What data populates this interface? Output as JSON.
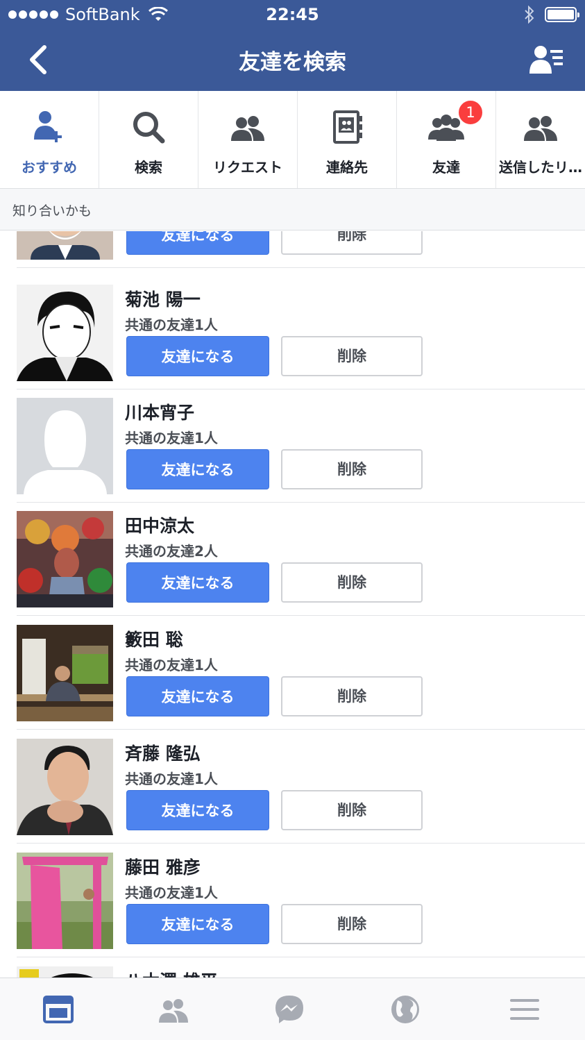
{
  "status_bar": {
    "carrier": "SoftBank",
    "time": "22:45"
  },
  "nav": {
    "title": "友達を検索",
    "back_icon": "chevron-left-icon",
    "right_icon": "friends-list-icon"
  },
  "tabs": [
    {
      "label": "おすすめ",
      "icon": "add-friend-icon",
      "active": true
    },
    {
      "label": "検索",
      "icon": "search-icon",
      "active": false
    },
    {
      "label": "リクエスト",
      "icon": "friend-requests-icon",
      "badge": "1",
      "active": false
    },
    {
      "label": "連絡先",
      "icon": "contacts-icon",
      "active": false
    },
    {
      "label": "友達",
      "icon": "friends-icon",
      "active": false
    },
    {
      "label": "送信したリ…",
      "icon": "sent-requests-icon",
      "active": false
    }
  ],
  "section_header": "知り合いかも",
  "suggestions": [
    {
      "name": "",
      "mutual": "",
      "add_label": "友達になる",
      "delete_label": "削除"
    },
    {
      "name": "菊池 陽一",
      "mutual": "共通の友達1人",
      "add_label": "友達になる",
      "delete_label": "削除"
    },
    {
      "name": "川本宵子",
      "mutual": "共通の友達1人",
      "add_label": "友達になる",
      "delete_label": "削除"
    },
    {
      "name": "田中涼太",
      "mutual": "共通の友達2人",
      "add_label": "友達になる",
      "delete_label": "削除"
    },
    {
      "name": "籔田 聡",
      "mutual": "共通の友達1人",
      "add_label": "友達になる",
      "delete_label": "削除"
    },
    {
      "name": "斉藤 隆弘",
      "mutual": "共通の友達1人",
      "add_label": "友達になる",
      "delete_label": "削除"
    },
    {
      "name": "藤田 雅彦",
      "mutual": "共通の友達1人",
      "add_label": "友達になる",
      "delete_label": "削除"
    },
    {
      "name": "八木澤 雄平",
      "mutual": "",
      "add_label": "",
      "delete_label": ""
    }
  ],
  "bottom_tabs": [
    {
      "icon": "news-feed-icon",
      "active": true
    },
    {
      "icon": "friend-requests-icon",
      "active": false
    },
    {
      "icon": "messenger-icon",
      "active": false
    },
    {
      "icon": "notifications-globe-icon",
      "active": false
    },
    {
      "icon": "menu-icon",
      "active": false
    }
  ],
  "colors": {
    "header_blue": "#3b5998",
    "accent_blue": "#4267b2",
    "button_blue": "#4d83ef",
    "badge_red": "#fa3e3e"
  }
}
